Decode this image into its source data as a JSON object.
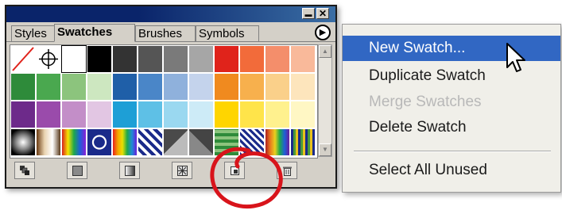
{
  "titlebar": {
    "minimize_glyph": "▬",
    "close_glyph": "✕"
  },
  "tabs": [
    {
      "label": "Styles",
      "active": false
    },
    {
      "label": "Swatches",
      "active": true
    },
    {
      "label": "Brushes",
      "active": false
    },
    {
      "label": "Symbols",
      "active": false
    }
  ],
  "panel_menu_button": "▶",
  "swatches": {
    "rows": [
      [
        "none",
        "registration",
        "#ffffff",
        "#000000",
        "#333333",
        "#555555",
        "#7a7a7a",
        "#a6a6a6",
        "#e0231b",
        "#f26b3a",
        "#f48e6b",
        "#f9b99a"
      ],
      [
        "#2e8b3a",
        "#4aa84f",
        "#8cc47d",
        "#cde7c0",
        "#1f5fa8",
        "#4a86c8",
        "#8fb1dc",
        "#c4d3ec",
        "#f08a1f",
        "#f7b04d",
        "#fad08a",
        "#fde5bc"
      ],
      [
        "#6d2a8a",
        "#9a4bab",
        "#c38ec8",
        "#e2c6e3",
        "#1e9fd6",
        "#5ec0e6",
        "#9ad8f0",
        "#cdebf7",
        "#ffd500",
        "#ffe44a",
        "#fff18e",
        "#fff7c4"
      ],
      [
        "gradient-radial-gray",
        "gradient-spectrum",
        "gradient-spectrum-2",
        "pattern-blue-dot",
        "gradient-spectrum-3",
        "pattern-blue-star",
        "pattern-diamond",
        "pattern-diamond-2",
        "pattern-green-wave",
        "pattern-blue-grid",
        "pattern-red-spectrum",
        "pattern-blue-multi"
      ]
    ]
  },
  "bottom_buttons": [
    {
      "name": "show-all-swatches-button",
      "icon": "all-swatches-icon"
    },
    {
      "name": "show-color-swatches-button",
      "icon": "color-swatches-icon"
    },
    {
      "name": "show-gradient-swatches-button",
      "icon": "gradient-swatches-icon"
    },
    {
      "name": "show-pattern-swatches-button",
      "icon": "pattern-swatches-icon"
    },
    {
      "name": "new-swatch-button",
      "icon": "new-swatch-icon"
    },
    {
      "name": "delete-swatch-button",
      "icon": "trash-icon"
    }
  ],
  "menu": {
    "items": [
      {
        "label": "New Swatch...",
        "highlighted": true,
        "disabled": false
      },
      {
        "label": "Duplicate Swatch",
        "highlighted": false,
        "disabled": false
      },
      {
        "label": "Merge Swatches",
        "highlighted": false,
        "disabled": true
      },
      {
        "label": "Delete Swatch",
        "highlighted": false,
        "disabled": false
      },
      {
        "label": "Select All Unused",
        "highlighted": false,
        "disabled": false
      }
    ]
  },
  "colors": {
    "titlebar": "#0a246a",
    "menu_highlight": "#3167c3",
    "annotation_circle": "#d8141b"
  }
}
